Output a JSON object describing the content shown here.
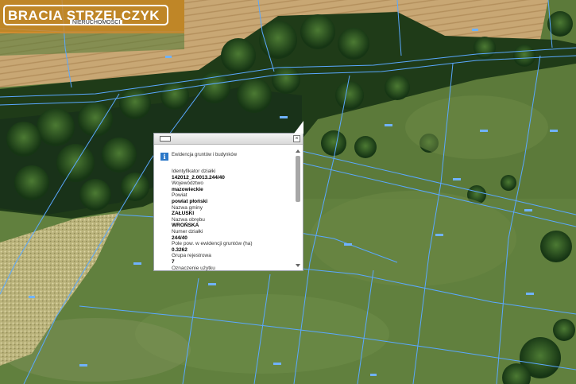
{
  "logo": {
    "brand": "BRACIA STRZELCZYK",
    "sub": "NIERUCHOMOŚCI"
  },
  "popup": {
    "title": "Ewidencja gruntów i budynków",
    "rows": [
      {
        "label": "Identyfikator działki",
        "value": "142012_2.0013.244/40"
      },
      {
        "label": "Województwo",
        "value": "mazowieckie"
      },
      {
        "label": "Powiat",
        "value": "powiat płoński"
      },
      {
        "label": "Nazwa gminy",
        "value": "ZAŁUSKI"
      },
      {
        "label": "Nazwa obrębu",
        "value": "WROŃSKA"
      },
      {
        "label": "Numer działki",
        "value": "244/40"
      },
      {
        "label": "Pole pow. w ewidencji gruntów (ha)",
        "value": "0.3262"
      },
      {
        "label": "Grupa rejestrowa",
        "value": "7"
      },
      {
        "label": "Oznaczenie użytku",
        "value": ""
      }
    ],
    "icons": [
      "maximize-icon",
      "close-icon",
      "info-icon"
    ]
  },
  "colors": {
    "parcel_lines": "#5aa8ff",
    "logo_bg": "#d68923",
    "info_icon": "#2c78c8"
  }
}
